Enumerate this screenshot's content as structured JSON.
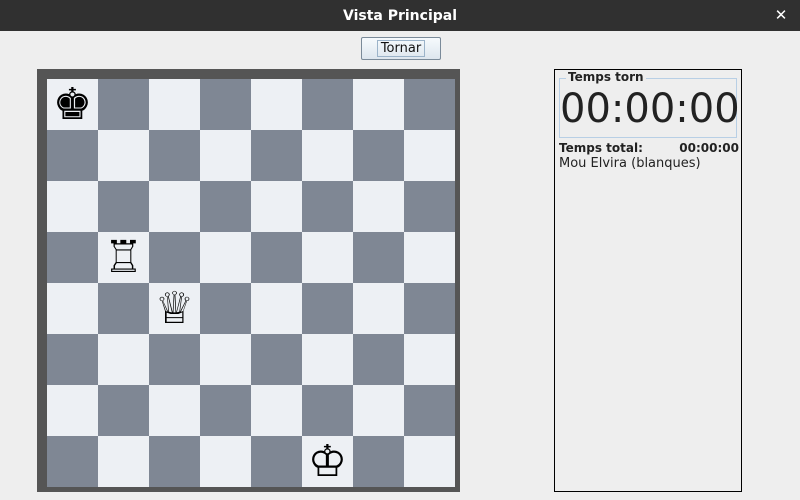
{
  "window": {
    "title": "Vista Principal",
    "close_icon": "close-icon"
  },
  "toolbar": {
    "back_label": "Tornar"
  },
  "board": {
    "ranks": [
      [
        {
          "color": "light",
          "piece": "♚",
          "name": "black-king"
        },
        {
          "color": "dark",
          "piece": "",
          "name": ""
        },
        {
          "color": "light",
          "piece": "",
          "name": ""
        },
        {
          "color": "dark",
          "piece": "",
          "name": ""
        },
        {
          "color": "light",
          "piece": "",
          "name": ""
        },
        {
          "color": "dark",
          "piece": "",
          "name": ""
        },
        {
          "color": "light",
          "piece": "",
          "name": ""
        },
        {
          "color": "dark",
          "piece": "",
          "name": ""
        }
      ],
      [
        {
          "color": "dark",
          "piece": "",
          "name": ""
        },
        {
          "color": "light",
          "piece": "",
          "name": ""
        },
        {
          "color": "dark",
          "piece": "",
          "name": ""
        },
        {
          "color": "light",
          "piece": "",
          "name": ""
        },
        {
          "color": "dark",
          "piece": "",
          "name": ""
        },
        {
          "color": "light",
          "piece": "",
          "name": ""
        },
        {
          "color": "dark",
          "piece": "",
          "name": ""
        },
        {
          "color": "light",
          "piece": "",
          "name": ""
        }
      ],
      [
        {
          "color": "light",
          "piece": "",
          "name": ""
        },
        {
          "color": "dark",
          "piece": "",
          "name": ""
        },
        {
          "color": "light",
          "piece": "",
          "name": ""
        },
        {
          "color": "dark",
          "piece": "",
          "name": ""
        },
        {
          "color": "light",
          "piece": "",
          "name": ""
        },
        {
          "color": "dark",
          "piece": "",
          "name": ""
        },
        {
          "color": "light",
          "piece": "",
          "name": ""
        },
        {
          "color": "dark",
          "piece": "",
          "name": ""
        }
      ],
      [
        {
          "color": "dark",
          "piece": "",
          "name": ""
        },
        {
          "color": "light",
          "piece": "♖",
          "name": "white-rook"
        },
        {
          "color": "dark",
          "piece": "",
          "name": ""
        },
        {
          "color": "light",
          "piece": "",
          "name": ""
        },
        {
          "color": "dark",
          "piece": "",
          "name": ""
        },
        {
          "color": "light",
          "piece": "",
          "name": ""
        },
        {
          "color": "dark",
          "piece": "",
          "name": ""
        },
        {
          "color": "light",
          "piece": "",
          "name": ""
        }
      ],
      [
        {
          "color": "light",
          "piece": "",
          "name": ""
        },
        {
          "color": "dark",
          "piece": "",
          "name": ""
        },
        {
          "color": "light",
          "piece": "♕",
          "name": "white-queen"
        },
        {
          "color": "dark",
          "piece": "",
          "name": ""
        },
        {
          "color": "light",
          "piece": "",
          "name": ""
        },
        {
          "color": "dark",
          "piece": "",
          "name": ""
        },
        {
          "color": "light",
          "piece": "",
          "name": ""
        },
        {
          "color": "dark",
          "piece": "",
          "name": ""
        }
      ],
      [
        {
          "color": "dark",
          "piece": "",
          "name": ""
        },
        {
          "color": "light",
          "piece": "",
          "name": ""
        },
        {
          "color": "dark",
          "piece": "",
          "name": ""
        },
        {
          "color": "light",
          "piece": "",
          "name": ""
        },
        {
          "color": "dark",
          "piece": "",
          "name": ""
        },
        {
          "color": "light",
          "piece": "",
          "name": ""
        },
        {
          "color": "dark",
          "piece": "",
          "name": ""
        },
        {
          "color": "light",
          "piece": "",
          "name": ""
        }
      ],
      [
        {
          "color": "light",
          "piece": "",
          "name": ""
        },
        {
          "color": "dark",
          "piece": "",
          "name": ""
        },
        {
          "color": "light",
          "piece": "",
          "name": ""
        },
        {
          "color": "dark",
          "piece": "",
          "name": ""
        },
        {
          "color": "light",
          "piece": "",
          "name": ""
        },
        {
          "color": "dark",
          "piece": "",
          "name": ""
        },
        {
          "color": "light",
          "piece": "",
          "name": ""
        },
        {
          "color": "dark",
          "piece": "",
          "name": ""
        }
      ],
      [
        {
          "color": "dark",
          "piece": "",
          "name": ""
        },
        {
          "color": "light",
          "piece": "",
          "name": ""
        },
        {
          "color": "dark",
          "piece": "",
          "name": ""
        },
        {
          "color": "light",
          "piece": "",
          "name": ""
        },
        {
          "color": "dark",
          "piece": "",
          "name": ""
        },
        {
          "color": "light",
          "piece": "♔",
          "name": "white-king"
        },
        {
          "color": "dark",
          "piece": "",
          "name": ""
        },
        {
          "color": "light",
          "piece": "",
          "name": ""
        }
      ]
    ]
  },
  "side_panel": {
    "turn_title": "Temps torn",
    "turn_clock": "00:00:00",
    "total_label": "Temps total:",
    "total_value": "00:00:00",
    "player": "Mou Elvira (blanques)"
  },
  "colors": {
    "light_square": "#edf0f4",
    "dark_square": "#7f8794",
    "titlebar": "#303030"
  }
}
